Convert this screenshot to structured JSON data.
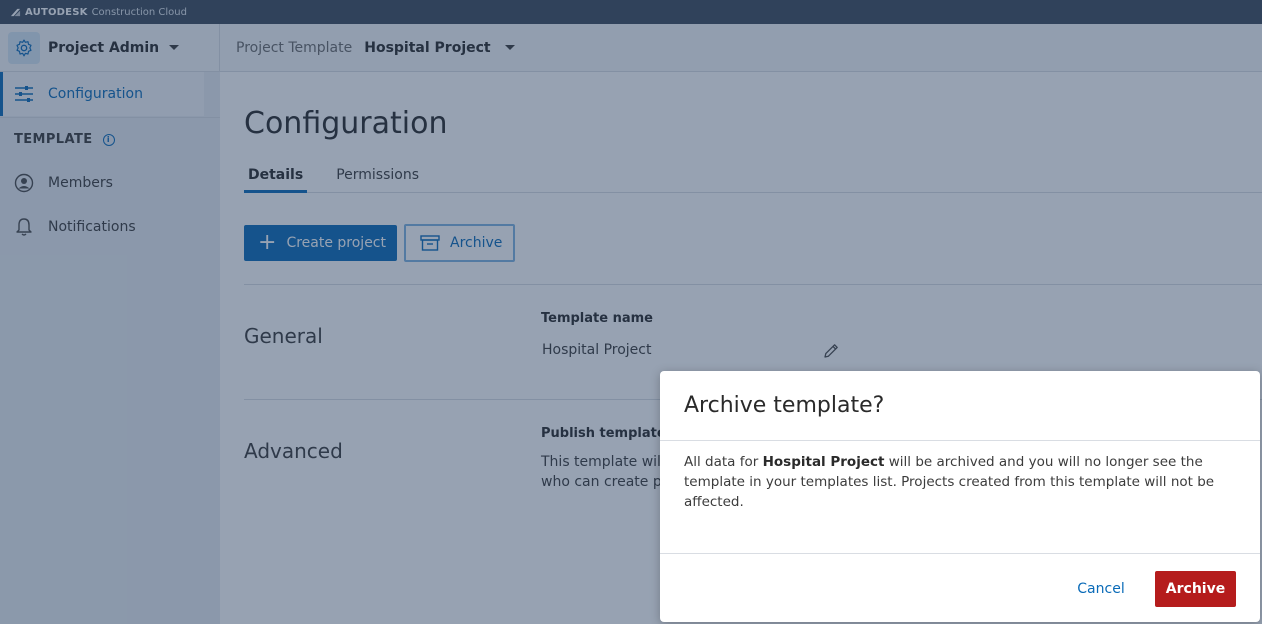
{
  "brand": {
    "name": "AUTODESK",
    "product": "Construction Cloud"
  },
  "header": {
    "module_name": "Project Admin",
    "crumb_label": "Project Template",
    "crumb_value": "Hospital Project"
  },
  "sidebar": {
    "active_item": "Configuration",
    "section_label": "TEMPLATE",
    "items": [
      {
        "label": "Members",
        "icon": "person-icon"
      },
      {
        "label": "Notifications",
        "icon": "bell-icon"
      }
    ]
  },
  "main": {
    "title": "Configuration",
    "tabs": [
      {
        "label": "Details",
        "active": true
      },
      {
        "label": "Permissions",
        "active": false
      }
    ],
    "create_button": "Create project",
    "archive_button": "Archive",
    "general": {
      "title": "General",
      "field_label": "Template name",
      "field_value": "Hospital Project"
    },
    "advanced": {
      "title": "Advanced",
      "field_label": "Publish template",
      "field_text": "This template will be visible to\nwho can create projects"
    }
  },
  "modal": {
    "title": "Archive template?",
    "body_prefix": "All data for ",
    "body_bold": "Hospital Project",
    "body_suffix": " will be archived and you will no longer see the template in your templates list. Projects created from this template will not be affected.",
    "cancel_label": "Cancel",
    "confirm_label": "Archive"
  },
  "colors": {
    "accent": "#0a6bb8",
    "danger": "#b51c1c",
    "brandbar": "#3d4b5c"
  }
}
